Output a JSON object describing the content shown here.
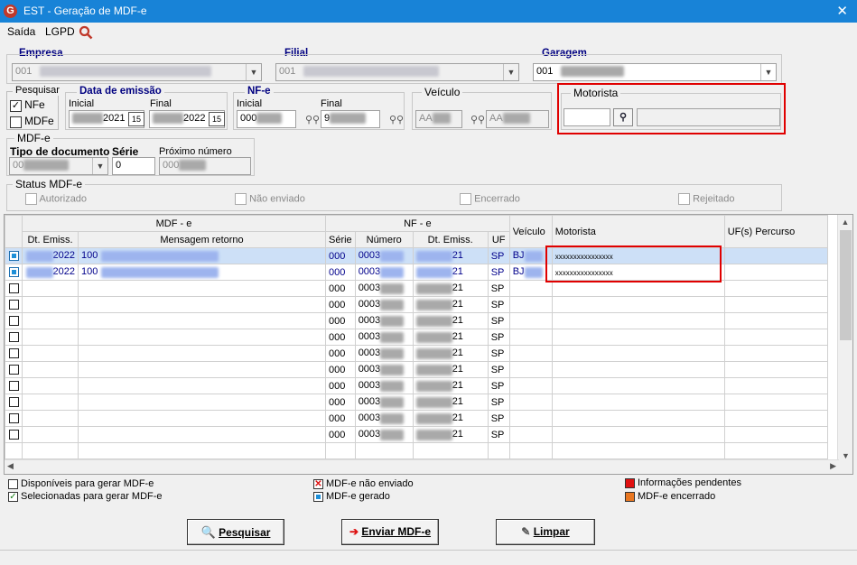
{
  "window": {
    "title": "EST - Geração de MDF-e",
    "close": "✕"
  },
  "menu": {
    "saida": "Saída",
    "lgpd": "LGPD"
  },
  "empresa": {
    "label": "Empresa",
    "value": "001"
  },
  "filial": {
    "label": "Filial",
    "value": "001"
  },
  "garagem": {
    "label": "Garagem",
    "value": "001"
  },
  "pesquisar": {
    "label": "Pesquisar",
    "nfe": "NFe",
    "mdfe": "MDFe"
  },
  "data_emissao": {
    "label": "Data de emissão",
    "inicial_label": "Inicial",
    "final_label": "Final",
    "inicial_value": "2021",
    "final_value": "2022"
  },
  "nfe": {
    "label": "NF-e",
    "inicial_label": "Inicial",
    "final_label": "Final",
    "inicial_value": "000",
    "final_value": "9"
  },
  "veiculo": {
    "label": "Veículo",
    "v1": "AA",
    "v2": "AA"
  },
  "motorista": {
    "label": "Motorista"
  },
  "mdfe_box": {
    "label": "MDF-e",
    "tipo_label": "Tipo de documento",
    "serie_label": "Série",
    "proximo_label": "Próximo número",
    "tipo_value": "00",
    "serie_value": "0",
    "proximo_value": "000"
  },
  "status": {
    "label": "Status MDF-e",
    "autorizado": "Autorizado",
    "nao_enviado": "Não enviado",
    "encerrado": "Encerrado",
    "rejeitado": "Rejeitado"
  },
  "grid": {
    "group_mdfe": "MDF - e",
    "group_nfe": "NF - e",
    "col_dt_emiss": "Dt. Emiss.",
    "col_mensagem": "Mensagem retorno",
    "col_serie": "Série",
    "col_numero": "Número",
    "col_dt_emiss2": "Dt. Emiss.",
    "col_uf": "UF",
    "col_veiculo": "Veículo",
    "col_motorista": "Motorista",
    "col_ufs": "UF(s) Percurso",
    "rows": [
      {
        "checked": true,
        "mdfe_date": "2022",
        "msg": "100",
        "serie": "000",
        "numero": "0003",
        "nfe_date": "21",
        "uf": "SP",
        "veiculo": "BJ",
        "motorista": "xxxxxxxxxxxxxxxx"
      },
      {
        "checked": true,
        "mdfe_date": "2022",
        "msg": "100",
        "serie": "000",
        "numero": "0003",
        "nfe_date": "21",
        "uf": "SP",
        "veiculo": "BJ",
        "motorista": "xxxxxxxxxxxxxxxx"
      },
      {
        "checked": false,
        "mdfe_date": "",
        "msg": "",
        "serie": "000",
        "numero": "0003",
        "nfe_date": "21",
        "uf": "SP",
        "veiculo": "",
        "motorista": ""
      },
      {
        "checked": false,
        "mdfe_date": "",
        "msg": "",
        "serie": "000",
        "numero": "0003",
        "nfe_date": "21",
        "uf": "SP",
        "veiculo": "",
        "motorista": ""
      },
      {
        "checked": false,
        "mdfe_date": "",
        "msg": "",
        "serie": "000",
        "numero": "0003",
        "nfe_date": "21",
        "uf": "SP",
        "veiculo": "",
        "motorista": ""
      },
      {
        "checked": false,
        "mdfe_date": "",
        "msg": "",
        "serie": "000",
        "numero": "0003",
        "nfe_date": "21",
        "uf": "SP",
        "veiculo": "",
        "motorista": ""
      },
      {
        "checked": false,
        "mdfe_date": "",
        "msg": "",
        "serie": "000",
        "numero": "0003",
        "nfe_date": "21",
        "uf": "SP",
        "veiculo": "",
        "motorista": ""
      },
      {
        "checked": false,
        "mdfe_date": "",
        "msg": "",
        "serie": "000",
        "numero": "0003",
        "nfe_date": "21",
        "uf": "SP",
        "veiculo": "",
        "motorista": ""
      },
      {
        "checked": false,
        "mdfe_date": "",
        "msg": "",
        "serie": "000",
        "numero": "0003",
        "nfe_date": "21",
        "uf": "SP",
        "veiculo": "",
        "motorista": ""
      },
      {
        "checked": false,
        "mdfe_date": "",
        "msg": "",
        "serie": "000",
        "numero": "0003",
        "nfe_date": "21",
        "uf": "SP",
        "veiculo": "",
        "motorista": ""
      },
      {
        "checked": false,
        "mdfe_date": "",
        "msg": "",
        "serie": "000",
        "numero": "0003",
        "nfe_date": "21",
        "uf": "SP",
        "veiculo": "",
        "motorista": ""
      },
      {
        "checked": false,
        "mdfe_date": "",
        "msg": "",
        "serie": "000",
        "numero": "0003",
        "nfe_date": "21",
        "uf": "SP",
        "veiculo": "",
        "motorista": ""
      }
    ]
  },
  "legend": {
    "disponiveis": "Disponíveis para gerar MDF-e",
    "selecionadas": "Selecionadas para gerar MDF-e",
    "nao_enviado": "MDF-e não enviado",
    "gerado": "MDF-e gerado",
    "pendentes": "Informações pendentes",
    "encerrado": "MDF-e encerrado"
  },
  "colors": {
    "gerado": "#1d8fd8",
    "pendentes": "#e01010",
    "encerrado": "#e87722",
    "nao_enviado": "#d11"
  },
  "buttons": {
    "pesquisar": "Pesquisar",
    "enviar": "Enviar MDF-e",
    "limpar": "Limpar"
  }
}
